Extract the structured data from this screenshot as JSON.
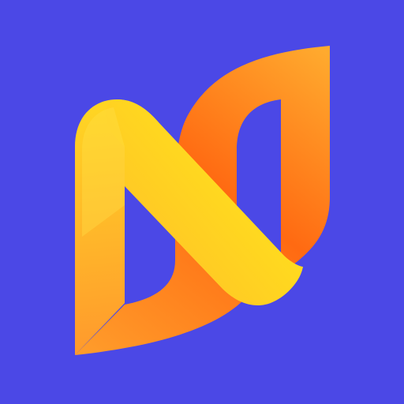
{
  "app_icon": {
    "icon": "letter-n-logo-icon",
    "colors": {
      "background": "#4B48E6",
      "yellow": "#FFD423",
      "yellow_light": "#FFE14A",
      "orange": "#FF8A1F",
      "orange_deep": "#FF6A12",
      "orange_light": "#FFAA2E"
    }
  }
}
